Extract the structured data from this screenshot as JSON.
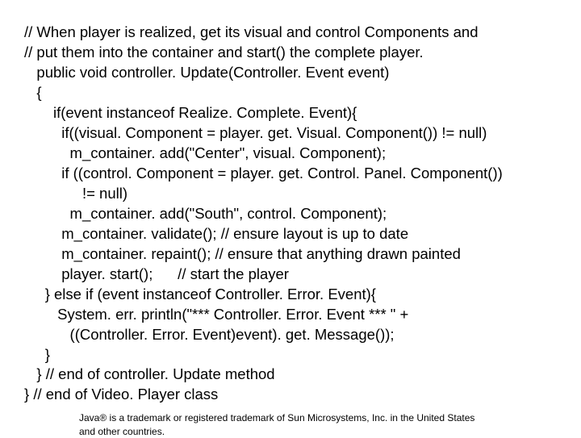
{
  "code": {
    "l01": "// When player is realized, get its visual and control Components and",
    "l02": "// put them into the container and start() the complete player.",
    "l03": "   public void controller. Update(Controller. Event event)",
    "l04": "   {",
    "l05": "       if(event instanceof Realize. Complete. Event){",
    "l06": "         if((visual. Component = player. get. Visual. Component()) != null)",
    "l07": "           m_container. add(\"Center\", visual. Component);",
    "l08": "         if ((control. Component = player. get. Control. Panel. Component())",
    "l09": "              != null)",
    "l10": "           m_container. add(\"South\", control. Component);",
    "l11": "         m_container. validate(); // ensure layout is up to date",
    "l12": "         m_container. repaint(); // ensure that anything drawn painted",
    "l13": "         player. start();      // start the player",
    "l14": "     } else if (event instanceof Controller. Error. Event){",
    "l15": "        System. err. println(\"*** Controller. Error. Event *** \" +",
    "l16": "           ((Controller. Error. Event)event). get. Message());",
    "l17": "     }",
    "l18": "   } // end of controller. Update method",
    "l19": "} // end of Video. Player class"
  },
  "footnote": "Java® is a trademark or registered trademark of Sun Microsystems, Inc. in the United States and other countries."
}
